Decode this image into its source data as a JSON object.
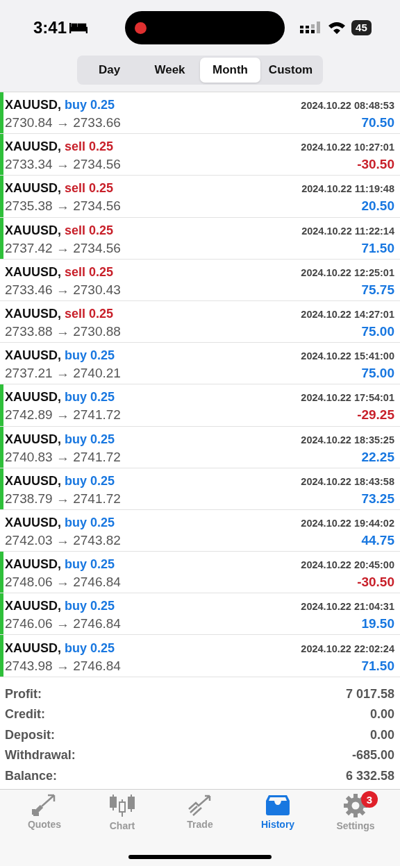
{
  "status_bar": {
    "time": "3:41",
    "battery": "45"
  },
  "periods": [
    {
      "label": "Day",
      "selected": false
    },
    {
      "label": "Week",
      "selected": false
    },
    {
      "label": "Month",
      "selected": true
    },
    {
      "label": "Custom",
      "selected": false
    }
  ],
  "deals": [
    {
      "symbol": "XAUUSD,",
      "kind": "buy",
      "action": "buy 0.25",
      "time": "2024.10.22 08:48:53",
      "prices": "2730.84 → 2733.66",
      "profit": "70.50",
      "loss": false,
      "highlighted": true
    },
    {
      "symbol": "XAUUSD,",
      "kind": "sell",
      "action": "sell 0.25",
      "time": "2024.10.22 10:27:01",
      "prices": "2733.34 → 2734.56",
      "profit": "-30.50",
      "loss": true,
      "highlighted": true
    },
    {
      "symbol": "XAUUSD,",
      "kind": "sell",
      "action": "sell 0.25",
      "time": "2024.10.22 11:19:48",
      "prices": "2735.38 → 2734.56",
      "profit": "20.50",
      "loss": false,
      "highlighted": true
    },
    {
      "symbol": "XAUUSD,",
      "kind": "sell",
      "action": "sell 0.25",
      "time": "2024.10.22 11:22:14",
      "prices": "2737.42 → 2734.56",
      "profit": "71.50",
      "loss": false,
      "highlighted": true
    },
    {
      "symbol": "XAUUSD,",
      "kind": "sell",
      "action": "sell 0.25",
      "time": "2024.10.22 12:25:01",
      "prices": "2733.46 → 2730.43",
      "profit": "75.75",
      "loss": false,
      "highlighted": false
    },
    {
      "symbol": "XAUUSD,",
      "kind": "sell",
      "action": "sell 0.25",
      "time": "2024.10.22 14:27:01",
      "prices": "2733.88 → 2730.88",
      "profit": "75.00",
      "loss": false,
      "highlighted": false
    },
    {
      "symbol": "XAUUSD,",
      "kind": "buy",
      "action": "buy 0.25",
      "time": "2024.10.22 15:41:00",
      "prices": "2737.21 → 2740.21",
      "profit": "75.00",
      "loss": false,
      "highlighted": false
    },
    {
      "symbol": "XAUUSD,",
      "kind": "buy",
      "action": "buy 0.25",
      "time": "2024.10.22 17:54:01",
      "prices": "2742.89 → 2741.72",
      "profit": "-29.25",
      "loss": true,
      "highlighted": true
    },
    {
      "symbol": "XAUUSD,",
      "kind": "buy",
      "action": "buy 0.25",
      "time": "2024.10.22 18:35:25",
      "prices": "2740.83 → 2741.72",
      "profit": "22.25",
      "loss": false,
      "highlighted": true
    },
    {
      "symbol": "XAUUSD,",
      "kind": "buy",
      "action": "buy 0.25",
      "time": "2024.10.22 18:43:58",
      "prices": "2738.79 → 2741.72",
      "profit": "73.25",
      "loss": false,
      "highlighted": true
    },
    {
      "symbol": "XAUUSD,",
      "kind": "buy",
      "action": "buy 0.25",
      "time": "2024.10.22 19:44:02",
      "prices": "2742.03 → 2743.82",
      "profit": "44.75",
      "loss": false,
      "highlighted": false
    },
    {
      "symbol": "XAUUSD,",
      "kind": "buy",
      "action": "buy 0.25",
      "time": "2024.10.22 20:45:00",
      "prices": "2748.06 → 2746.84",
      "profit": "-30.50",
      "loss": true,
      "highlighted": true
    },
    {
      "symbol": "XAUUSD,",
      "kind": "buy",
      "action": "buy 0.25",
      "time": "2024.10.22 21:04:31",
      "prices": "2746.06 → 2746.84",
      "profit": "19.50",
      "loss": false,
      "highlighted": true
    },
    {
      "symbol": "XAUUSD,",
      "kind": "buy",
      "action": "buy 0.25",
      "time": "2024.10.22 22:02:24",
      "prices": "2743.98 → 2746.84",
      "profit": "71.50",
      "loss": false,
      "highlighted": true
    }
  ],
  "summary": [
    {
      "label": "Profit:",
      "value": "7 017.58"
    },
    {
      "label": "Credit:",
      "value": "0.00"
    },
    {
      "label": "Deposit:",
      "value": "0.00"
    },
    {
      "label": "Withdrawal:",
      "value": "-685.00"
    },
    {
      "label": "Balance:",
      "value": "6 332.58"
    }
  ],
  "tab_bar": [
    {
      "kind": "quotes",
      "label": "Quotes",
      "selected": false
    },
    {
      "kind": "chart",
      "label": "Chart",
      "selected": false
    },
    {
      "kind": "trade",
      "label": "Trade",
      "selected": false
    },
    {
      "kind": "history",
      "label": "History",
      "selected": true
    },
    {
      "kind": "settings",
      "label": "Settings",
      "selected": false,
      "badge": "3"
    }
  ]
}
